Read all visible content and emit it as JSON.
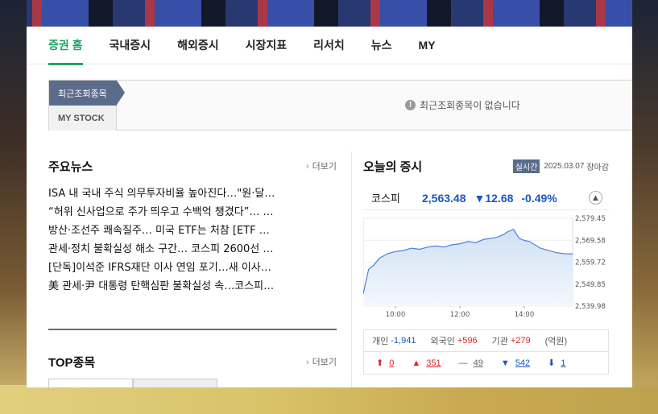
{
  "nav": {
    "items": [
      "증권 홈",
      "국내증시",
      "해외증시",
      "시장지표",
      "리서치",
      "뉴스",
      "MY"
    ]
  },
  "recent": {
    "tab_recent": "최근조회종목",
    "tab_mystock": "MY STOCK",
    "empty_message": "최근조회종목이 없습니다",
    "info_icon": "!"
  },
  "news": {
    "title": "주요뉴스",
    "more": "더보기",
    "items": [
      "ISA 내 국내 주식 의무투자비율 높아진다…\"원·달…",
      "“허위 신사업으로 주가 띄우고 수백억 챙겼다”… …",
      "방산·조선주 쾌속질주… 미국 ETF는 처참 [ETF …",
      "관세·정치 불확실성 해소 구간… 코스피 2600선 …",
      "[단독]이석준 IFRS재단 이사 연임 포기…새 이사…",
      "美 관세·尹 대통령 탄핵심판 불확실성 속…코스피…"
    ]
  },
  "top": {
    "title": "TOP종목",
    "more": "더보기"
  },
  "market": {
    "title": "오늘의 증시",
    "realtime": "실시간",
    "date": "2025.03.07",
    "status": "장마감",
    "index_name": "코스피",
    "index_value": "2,563.48",
    "change": "▼12.68",
    "change_pct": "-0.49%",
    "toggle_icon": "chevron-up-icon",
    "investors": {
      "individual_label": "개인",
      "individual_value": "-1,941",
      "foreign_label": "외국인",
      "foreign_value": "+596",
      "institution_label": "기관",
      "institution_value": "+279",
      "unit": "(억원)"
    },
    "counts": {
      "upper_limit": "0",
      "rise": "351",
      "flat": "49",
      "fall": "542",
      "lower_limit": "1"
    }
  },
  "chart_data": {
    "type": "area",
    "x_ticks": [
      "10:00",
      "12:00",
      "14:00"
    ],
    "y_ticks": [
      "2,579.45",
      "2,569.58",
      "2,559.72",
      "2,549.85",
      "2,539.98"
    ],
    "ylim": [
      2539.98,
      2579.45
    ],
    "x_range": [
      "09:00",
      "15:30"
    ],
    "series": [
      {
        "x": [
          "09:00",
          "09:05",
          "09:10",
          "09:20",
          "09:30",
          "09:45",
          "10:00",
          "10:15",
          "10:30",
          "10:45",
          "11:00",
          "11:15",
          "11:30",
          "11:45",
          "12:00",
          "12:15",
          "12:30",
          "12:45",
          "13:00",
          "13:10",
          "13:20",
          "13:30",
          "13:40",
          "13:50",
          "14:00",
          "14:10",
          "14:20",
          "14:30",
          "14:45",
          "15:00",
          "15:15",
          "15:30"
        ],
        "values": [
          2545.5,
          2551.0,
          2556.5,
          2558.5,
          2561.5,
          2563.5,
          2564.5,
          2565.0,
          2566.0,
          2565.5,
          2566.5,
          2567.0,
          2566.5,
          2567.5,
          2568.0,
          2569.0,
          2568.5,
          2570.0,
          2570.5,
          2571.0,
          2572.0,
          2573.5,
          2574.5,
          2570.5,
          2569.5,
          2569.0,
          2567.5,
          2566.0,
          2565.0,
          2564.0,
          2563.5,
          2563.48
        ]
      }
    ],
    "line_color": "#4a7fd4",
    "fill_color": "#cfe0f5",
    "grid": true
  }
}
